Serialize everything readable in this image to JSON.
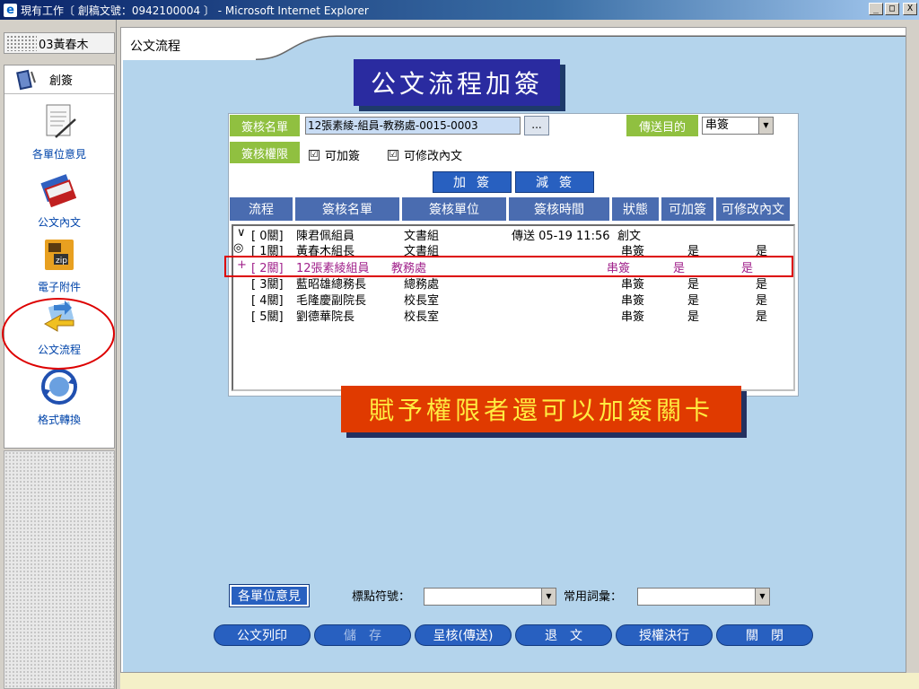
{
  "window": {
    "title": "現有工作〔 創稿文號：0942100004 〕 - Microsoft Internet Explorer",
    "min": "_",
    "max": "□",
    "close": "X"
  },
  "sidebar": {
    "user": "03黃春木",
    "top_item": "創簽",
    "items": [
      {
        "label": "各單位意見",
        "icon": "document-pen-icon"
      },
      {
        "label": "公文內文",
        "icon": "folders-icon"
      },
      {
        "label": "電子附件",
        "icon": "zip-folder-icon"
      },
      {
        "label": "公文流程",
        "icon": "flow-arrows-icon",
        "selected": true
      },
      {
        "label": "格式轉換",
        "icon": "globe-refresh-icon"
      }
    ]
  },
  "main": {
    "tab": "公文流程",
    "banner_top": "公文流程加簽",
    "banner_bottom": "賦予權限者還可以加簽關卡",
    "form": {
      "list_label": "簽核名單",
      "list_value": "12張素綾-組員-教務處-0015-0003",
      "browse_button": "...",
      "dest_label": "傳送目的",
      "dest_value": "串簽",
      "perm_label": "簽核權限",
      "perm_add": "可加簽",
      "perm_add_checked": "☑",
      "perm_edit": "可修改內文",
      "perm_edit_checked": "☑",
      "add_button": "加簽",
      "remove_button": "減簽"
    },
    "table": {
      "headers": [
        "流程",
        "簽核名單",
        "簽核單位",
        "簽核時間",
        "狀態",
        "可加簽",
        "可修改內文"
      ],
      "rows": [
        {
          "mark": "∨",
          "step": "[ 0關]",
          "name": "陳君佩組員",
          "unit": "文書組",
          "time": "傳送 05-19 11:56",
          "status": "創文",
          "add": "",
          "edit": ""
        },
        {
          "mark": "◎",
          "step": "[ 1關]",
          "name": "黃春木組長",
          "unit": "文書組",
          "time": "",
          "status": "串簽",
          "add": "是",
          "edit": "是"
        },
        {
          "mark": "+",
          "step": "[ 2關]",
          "name": "12張素綾組員",
          "unit": "教務處",
          "time": "",
          "status": "串簽",
          "add": "是",
          "edit": "是",
          "highlight": true
        },
        {
          "mark": "",
          "step": "[ 3關]",
          "name": "藍昭雄總務長",
          "unit": "總務處",
          "time": "",
          "status": "串簽",
          "add": "是",
          "edit": "是"
        },
        {
          "mark": "",
          "step": "[ 4關]",
          "name": "毛隆慶副院長",
          "unit": "校長室",
          "time": "",
          "status": "串簽",
          "add": "是",
          "edit": "是"
        },
        {
          "mark": "",
          "step": "[ 5關]",
          "name": "劉德華院長",
          "unit": "校長室",
          "time": "",
          "status": "串簽",
          "add": "是",
          "edit": "是"
        }
      ]
    },
    "bottom": {
      "units_button": "各單位意見",
      "punct_label": "標點符號：",
      "phrase_label": "常用詞彙：",
      "buttons": [
        {
          "label": "公文列印",
          "enabled": true
        },
        {
          "label": "儲　存",
          "enabled": false
        },
        {
          "label": "呈核(傳送)",
          "enabled": true
        },
        {
          "label": "退　文",
          "enabled": true
        },
        {
          "label": "授權決行",
          "enabled": true
        },
        {
          "label": "關　閉",
          "enabled": true
        }
      ]
    }
  },
  "colors": {
    "banner_top_bg": "#2a2ba0",
    "banner_bottom_bg": "#e03a00",
    "banner_bottom_text": "#ffec40",
    "label_green": "#90c040",
    "button_blue": "#2860c0",
    "highlight_red": "#dd0000",
    "content_bg": "#b4d4ec"
  }
}
